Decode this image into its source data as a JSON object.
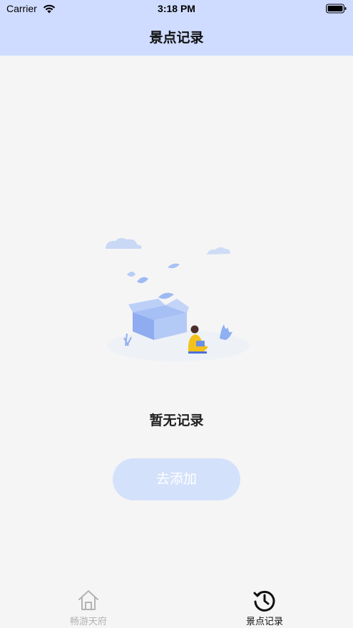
{
  "status_bar": {
    "carrier": "Carrier",
    "time": "3:18 PM"
  },
  "nav": {
    "title": "景点记录"
  },
  "empty_state": {
    "message": "暂无记录",
    "add_button_label": "去添加"
  },
  "tab_bar": {
    "tabs": [
      {
        "label": "畅游天府",
        "icon": "home-icon",
        "active": false
      },
      {
        "label": "景点记录",
        "icon": "history-icon",
        "active": true
      }
    ]
  },
  "colors": {
    "header_bg": "#cfdcff",
    "page_bg": "#f5f5f6",
    "button_bg": "#d4e1fb",
    "illustration_blue": "#8fb0f2",
    "active_tab": "#111111",
    "inactive_tab": "#b3b3b3"
  }
}
